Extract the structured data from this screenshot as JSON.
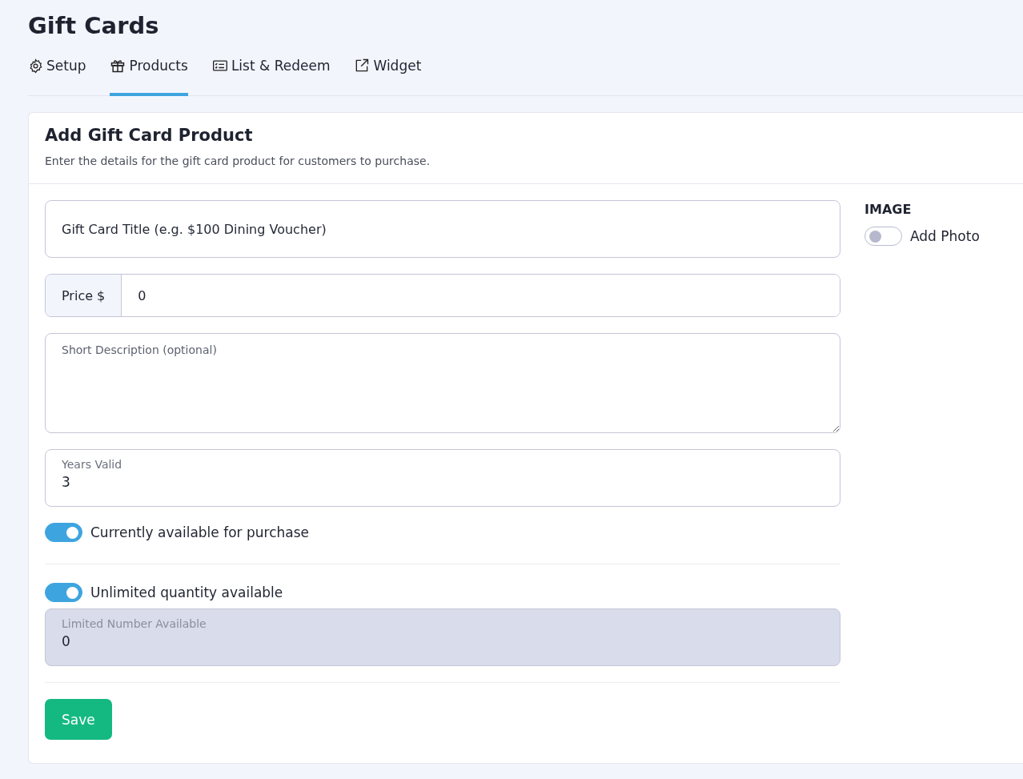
{
  "page_title": "Gift Cards",
  "tabs": [
    {
      "label": "Setup",
      "kind": "gear",
      "selected": false
    },
    {
      "label": "Products",
      "kind": "gift",
      "selected": true
    },
    {
      "label": "List & Redeem",
      "kind": "list",
      "selected": false
    },
    {
      "label": "Widget",
      "kind": "external",
      "selected": false
    }
  ],
  "card": {
    "title": "Add Gift Card Product",
    "subtitle": "Enter the details for the gift card product for customers to purchase."
  },
  "title_field": {
    "placeholder": "Gift Card Title (e.g. $100 Dining Voucher)"
  },
  "price_field": {
    "prefix": "Price $",
    "value": "0"
  },
  "description_field": {
    "placeholder": "Short Description (optional)"
  },
  "years_field": {
    "label": "Years Valid",
    "value": "3"
  },
  "available_toggle": {
    "label": "Currently available for purchase",
    "on": true
  },
  "unlimited_toggle": {
    "label": "Unlimited quantity available",
    "on": true
  },
  "limited_field": {
    "label": "Limited Number Available",
    "value": "0",
    "disabled": true
  },
  "save_button": "Save",
  "image": {
    "heading": "IMAGE",
    "toggle_label": "Add Photo",
    "on": false
  }
}
